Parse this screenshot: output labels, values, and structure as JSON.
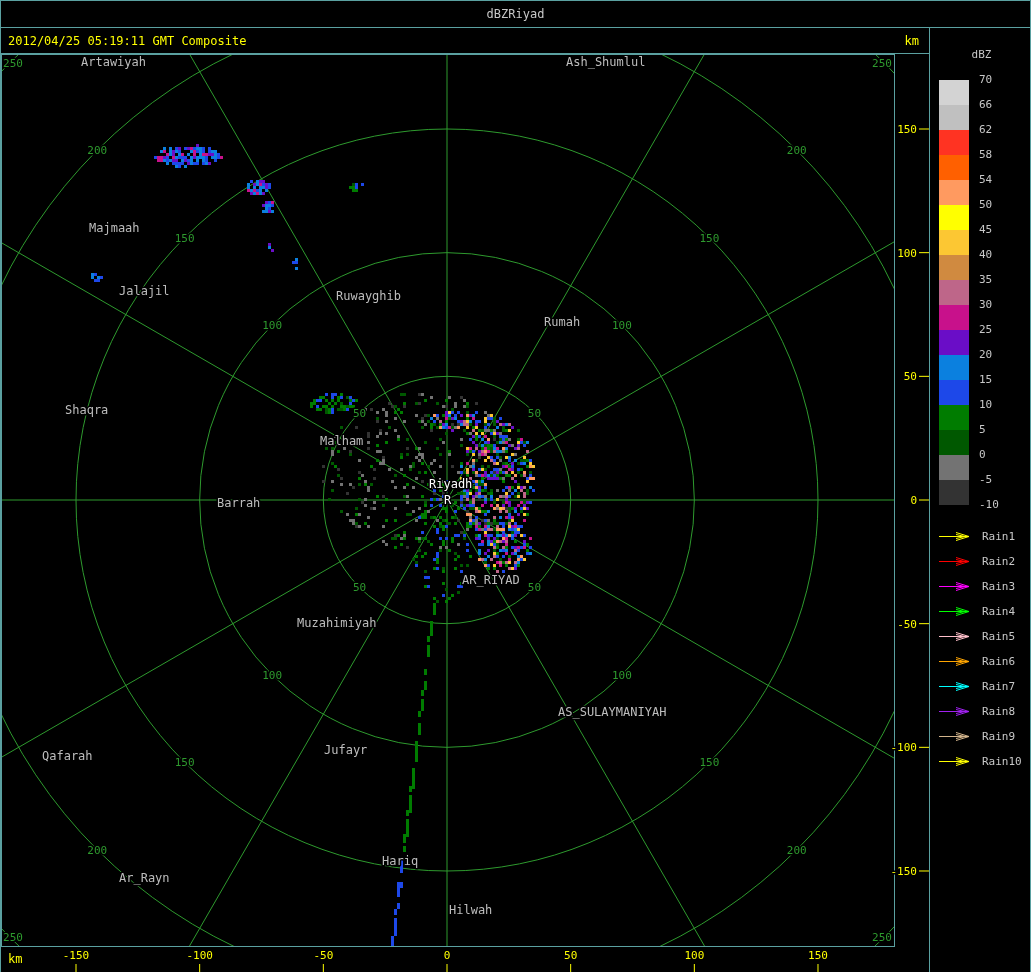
{
  "window": {
    "title": "dBZRiyad"
  },
  "header": {
    "timestamp": "2012/04/25 05:19:11 GMT Composite",
    "unit": "km"
  },
  "radar": {
    "rings": [
      {
        "labels": [
          "50",
          "50",
          "50",
          "50"
        ]
      },
      {
        "labels": [
          "100",
          "100",
          "100",
          "100"
        ]
      },
      {
        "labels": [
          "150",
          "150",
          "150",
          "150"
        ]
      },
      {
        "labels": [
          "200",
          "200",
          "200",
          "200"
        ]
      },
      {
        "labels": [
          "250",
          "250",
          "250",
          "250"
        ]
      }
    ],
    "places": [
      {
        "name": "Artawiyah",
        "kind": "town"
      },
      {
        "name": "Ash_Shumlul",
        "kind": "town"
      },
      {
        "name": "Majmaah",
        "kind": "town"
      },
      {
        "name": "Jalajil",
        "kind": "town"
      },
      {
        "name": "Ruwayghib",
        "kind": "town"
      },
      {
        "name": "Rumah",
        "kind": "town"
      },
      {
        "name": "Shaqra",
        "kind": "town"
      },
      {
        "name": "Malham",
        "kind": "town"
      },
      {
        "name": "Riyadh",
        "kind": "site"
      },
      {
        "name": "Barrah",
        "kind": "town"
      },
      {
        "name": "R",
        "kind": "site"
      },
      {
        "name": "AR_RIYAD",
        "kind": "town"
      },
      {
        "name": "Muzahimiyah",
        "kind": "town"
      },
      {
        "name": "AS_SULAYMANIYAH",
        "kind": "town"
      },
      {
        "name": "Jufayr",
        "kind": "town"
      },
      {
        "name": "Qafarah",
        "kind": "town"
      },
      {
        "name": "Hariq",
        "kind": "town"
      },
      {
        "name": "Ar_Rayn",
        "kind": "town"
      },
      {
        "name": "Hilwah",
        "kind": "town"
      }
    ],
    "x_axis": {
      "unit": "km",
      "ticks": [
        "-150",
        "-100",
        "-50",
        "0",
        "50",
        "100",
        "150"
      ]
    },
    "y_axis": {
      "ticks": [
        "150",
        "100",
        "50",
        "0",
        "-50",
        "-100",
        "-150"
      ]
    }
  },
  "legend": {
    "title": "dBZ",
    "levels": [
      {
        "label": "70",
        "color": "#d3d3d3"
      },
      {
        "label": "66",
        "color": "#c0c0c0"
      },
      {
        "label": "62",
        "color": "#ff3322"
      },
      {
        "label": "58",
        "color": "#ff6000"
      },
      {
        "label": "54",
        "color": "#ff9a60"
      },
      {
        "label": "50",
        "color": "#ffff00"
      },
      {
        "label": "45",
        "color": "#fcc733"
      },
      {
        "label": "40",
        "color": "#d08a40"
      },
      {
        "label": "35",
        "color": "#be6689"
      },
      {
        "label": "30",
        "color": "#c8118b"
      },
      {
        "label": "25",
        "color": "#6a0dc7"
      },
      {
        "label": "20",
        "color": "#0b80df"
      },
      {
        "label": "15",
        "color": "#1d48e9"
      },
      {
        "label": "10",
        "color": "#007c00"
      },
      {
        "label": "5",
        "color": "#005800"
      },
      {
        "label": "0",
        "color": "#737373"
      },
      {
        "label": "-5",
        "color": "#333333"
      }
    ],
    "scale_end": "-10",
    "tracks": [
      {
        "label": "Rain1",
        "color": "#ffff00"
      },
      {
        "label": "Rain2",
        "color": "#ff0000"
      },
      {
        "label": "Rain3",
        "color": "#ff00ff"
      },
      {
        "label": "Rain4",
        "color": "#00ff00"
      },
      {
        "label": "Rain5",
        "color": "#ffc0cb"
      },
      {
        "label": "Rain6",
        "color": "#ffa500"
      },
      {
        "label": "Rain7",
        "color": "#00ffff"
      },
      {
        "label": "Rain8",
        "color": "#a020f0"
      },
      {
        "label": "Rain9",
        "color": "#d2b48c"
      },
      {
        "label": "Rain10",
        "color": "#ffff00"
      }
    ]
  }
}
